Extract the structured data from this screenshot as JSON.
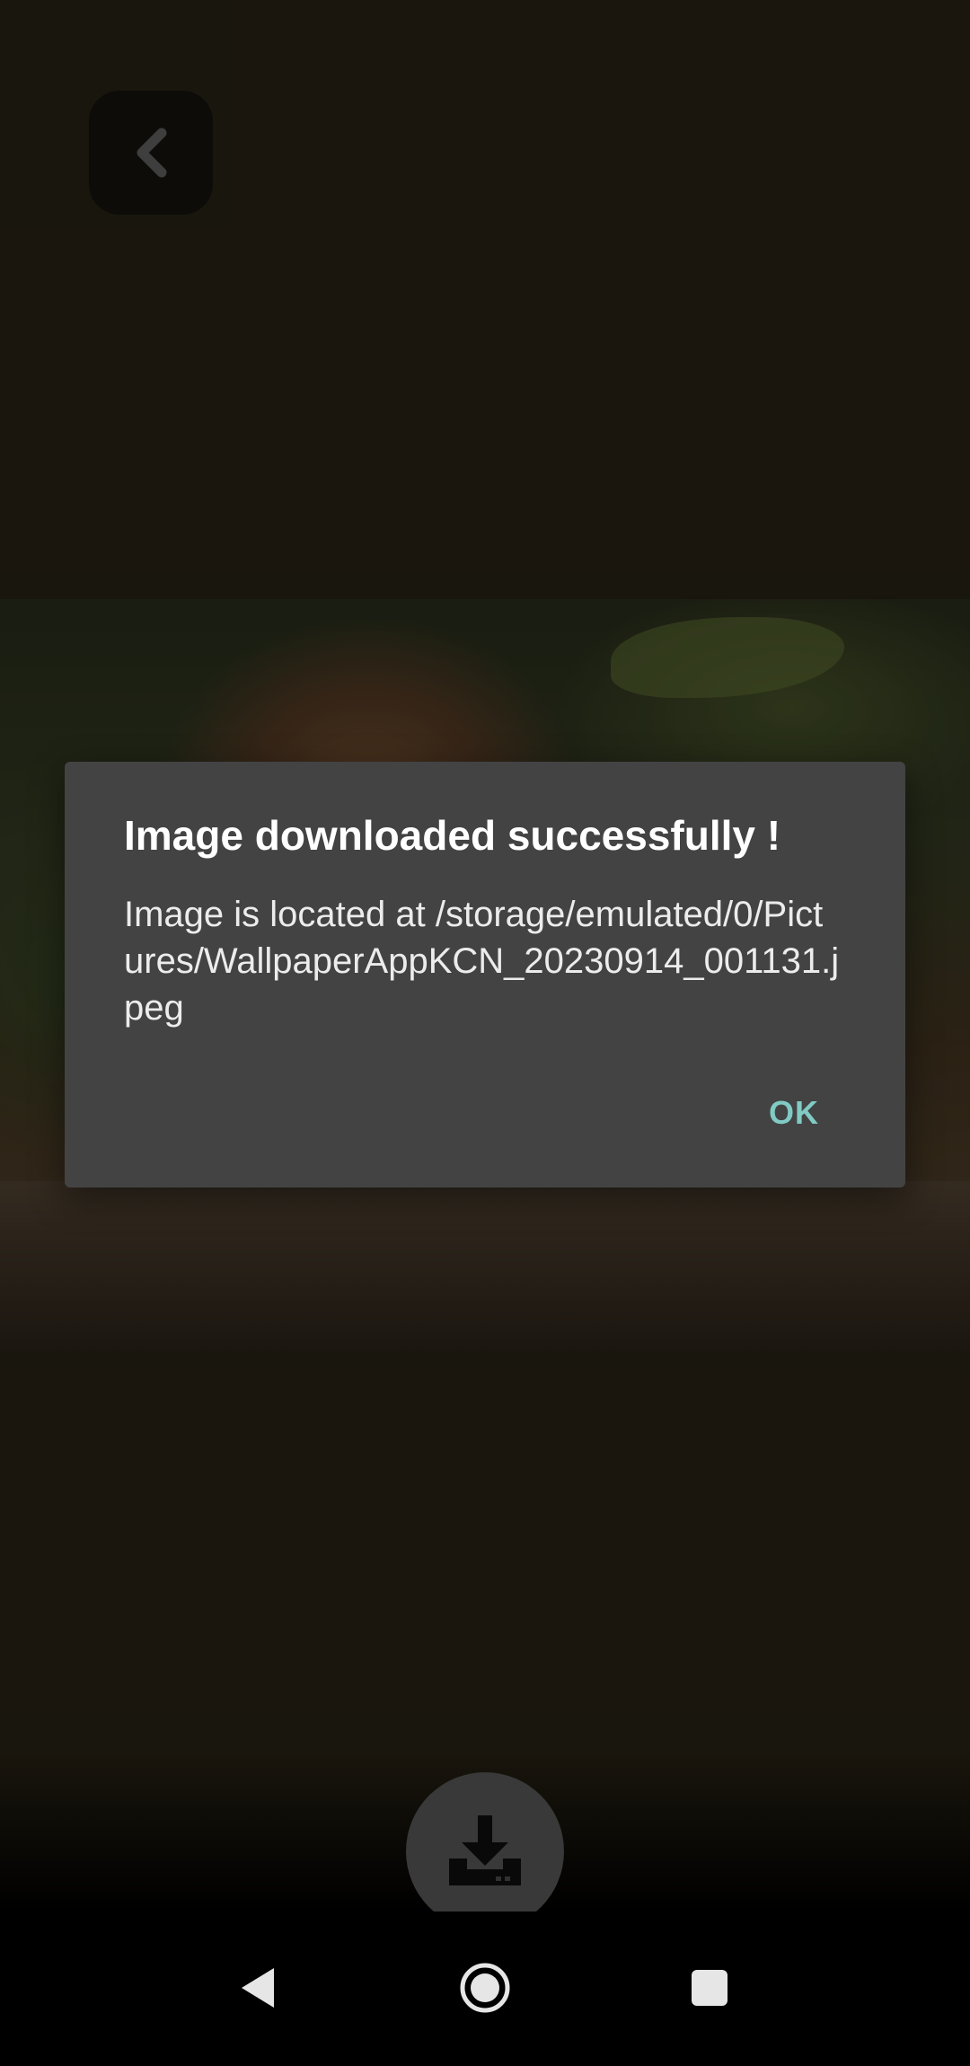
{
  "dialog": {
    "title": "Image downloaded successfully !",
    "message": "Image is located at /storage/emulated/0/Pictures/WallpaperAppKCN_20230914_001131.jpeg",
    "ok_label": "OK"
  },
  "icons": {
    "back": "chevron-left-icon",
    "download": "download-icon",
    "nav_back": "nav-back-icon",
    "nav_home": "nav-home-icon",
    "nav_recents": "nav-recents-icon"
  },
  "colors": {
    "background": "#2c2617",
    "dialog_bg": "#434343",
    "accent": "#80cbc4",
    "fab_bg": "#626262"
  }
}
